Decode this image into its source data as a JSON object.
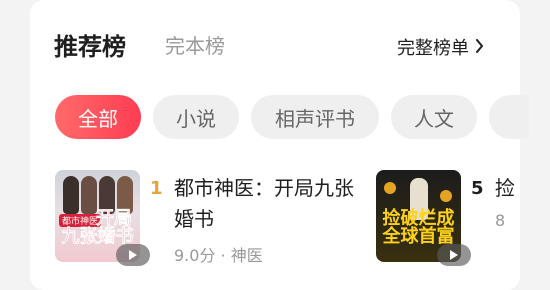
{
  "header": {
    "tab_active": "推荐榜",
    "tab_inactive": "完本榜",
    "full_list": "完整榜单"
  },
  "filters": [
    {
      "label": "全部",
      "active": true
    },
    {
      "label": "小说",
      "active": false
    },
    {
      "label": "相声评书",
      "active": false
    },
    {
      "label": "人文",
      "active": false
    }
  ],
  "books": [
    {
      "rank": "1",
      "title": "都市神医：开局九张婚书",
      "score": "9.0分",
      "separator": "·",
      "genre": "神医",
      "cover_text_line1": "开局",
      "cover_text_line2": "九张婚书",
      "cover_tag": "都市神医"
    },
    {
      "rank": "5",
      "title": "捡",
      "score": "8",
      "cover_text_line1": "捡破烂成",
      "cover_text_line2": "全球首富"
    }
  ],
  "colors": {
    "accent": "#ff4a5a",
    "rank_gold": "#e3a53b",
    "rank_dark": "#1f1f1f"
  }
}
